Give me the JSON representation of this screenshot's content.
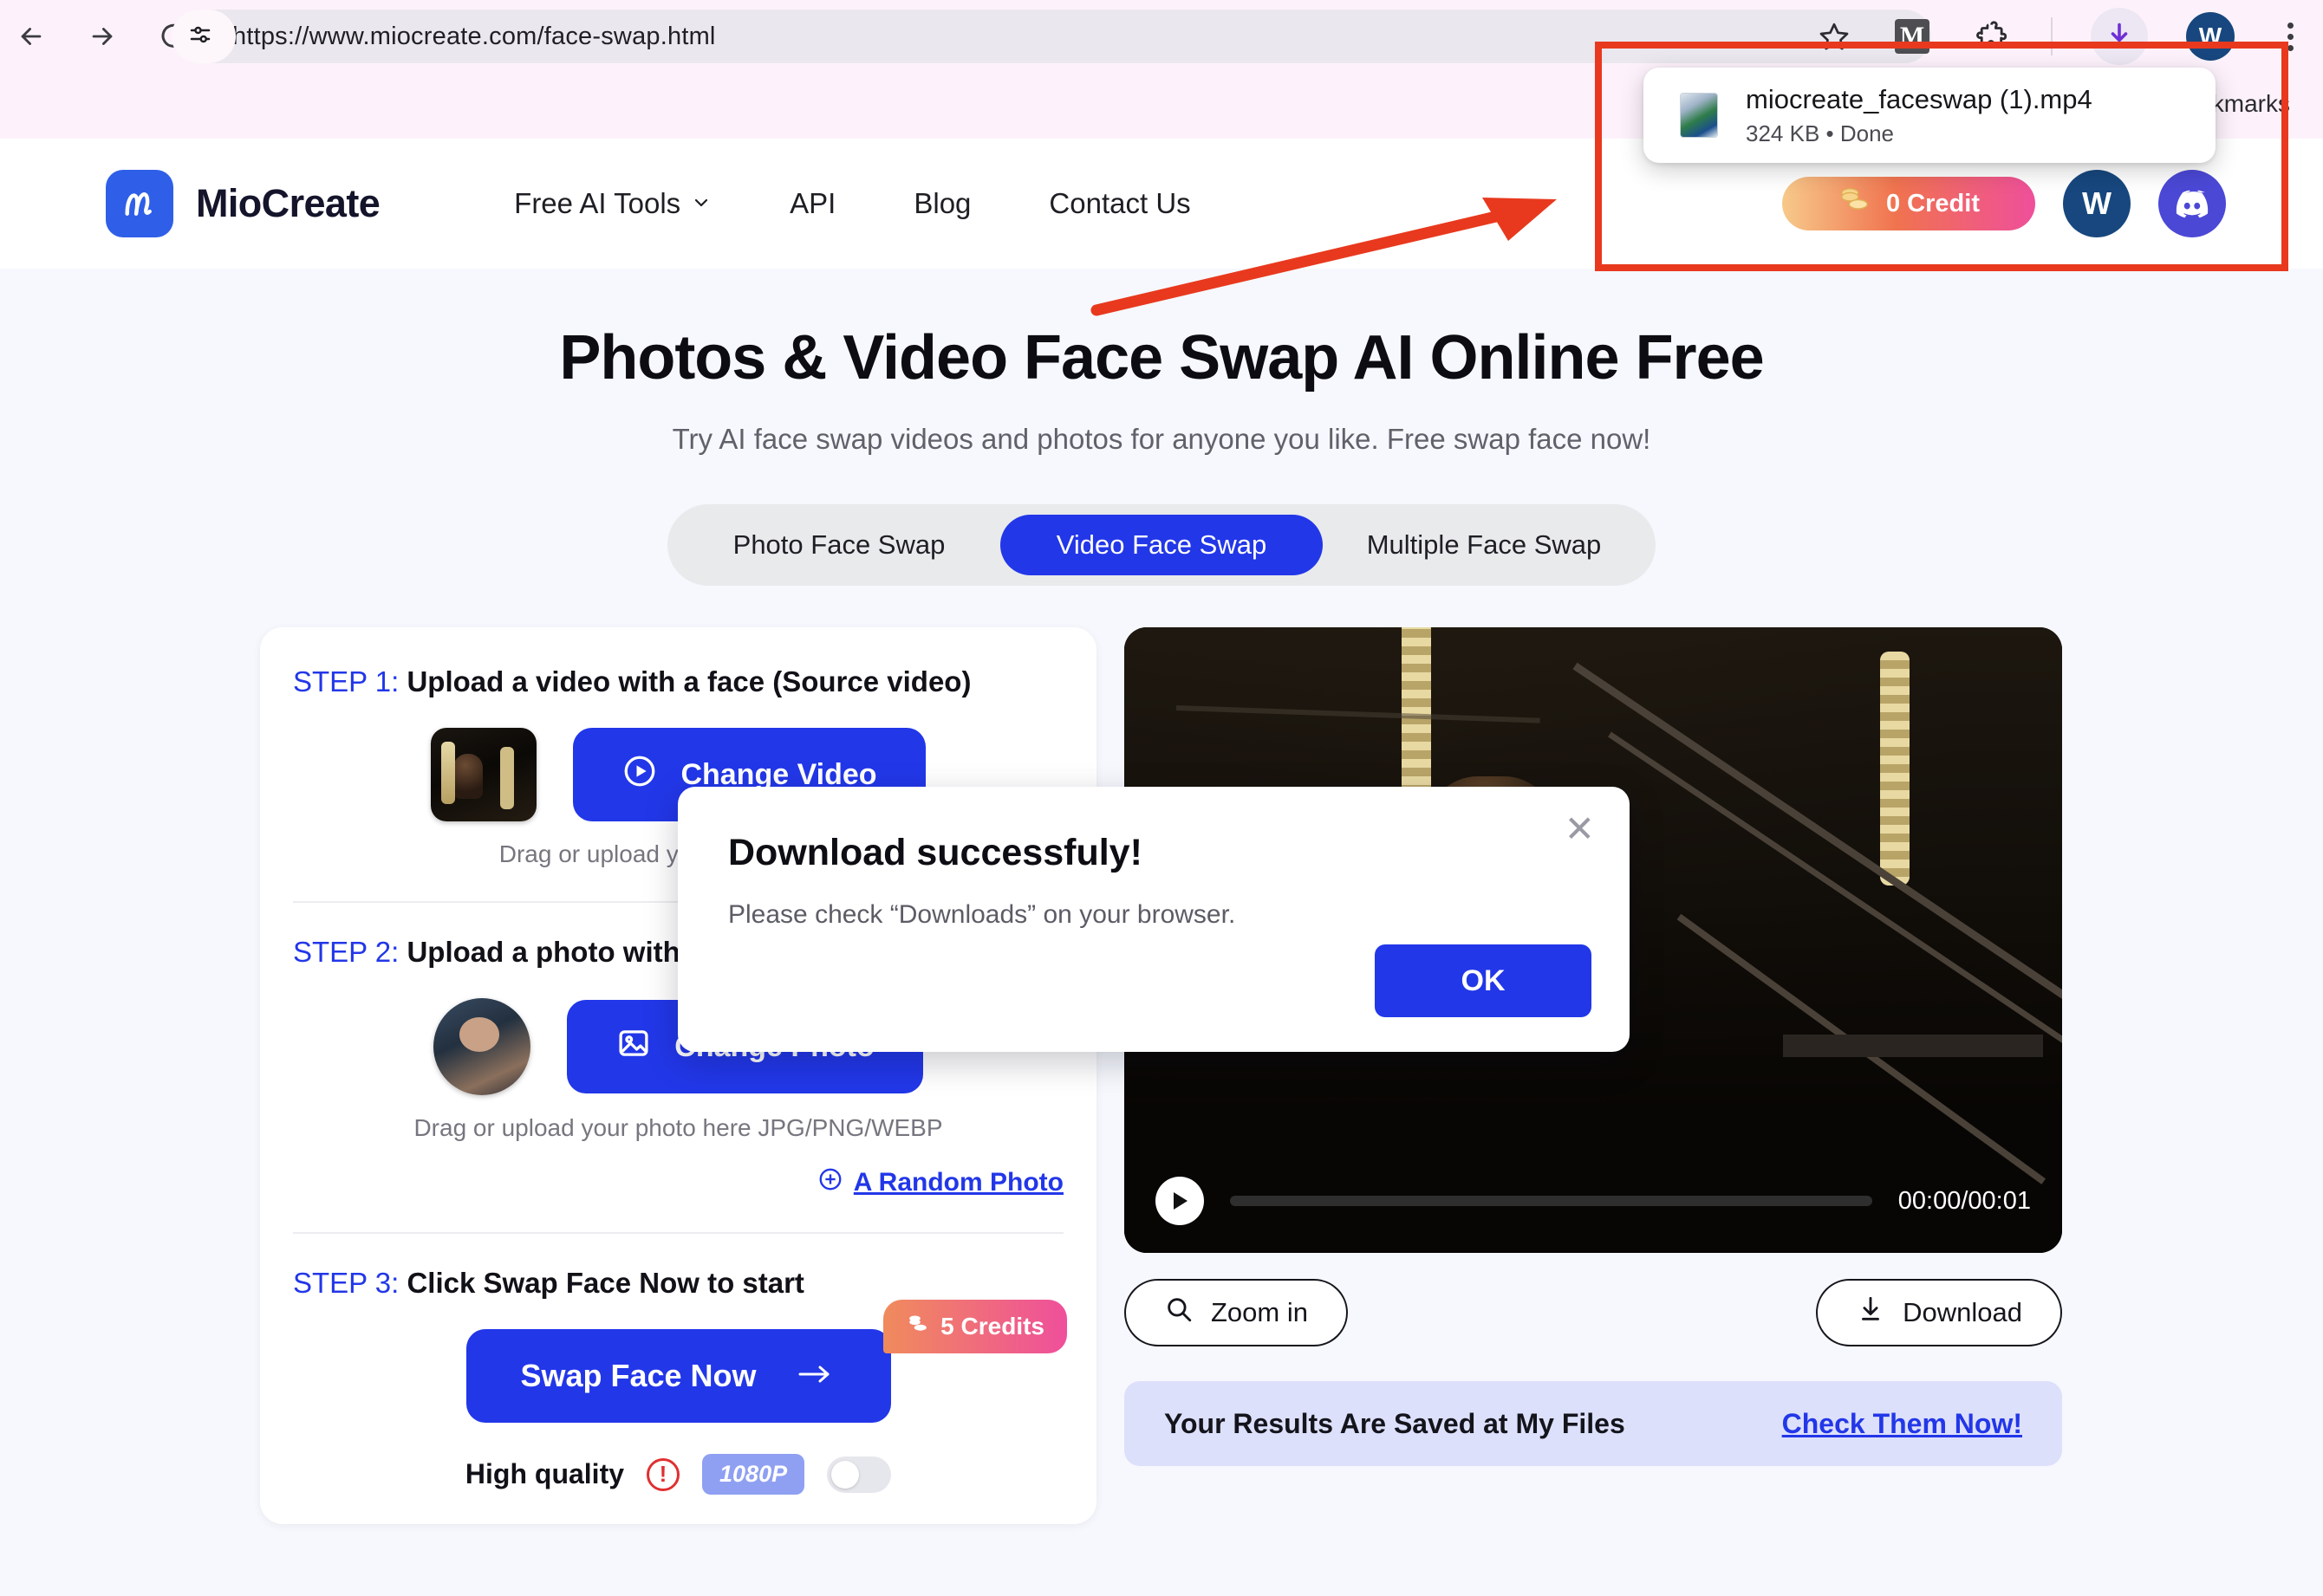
{
  "browser": {
    "url": "https://www.miocreate.com/face-swap.html",
    "back_icon": "back-arrow-icon",
    "forward_icon": "forward-arrow-icon",
    "reload_icon": "reload-icon",
    "site_info_icon": "site-settings-icon",
    "bookmark_star_icon": "star-icon",
    "extension_gmail_label": "M",
    "extension_puzzle_icon": "puzzle-icon",
    "downloads_icon": "download-icon",
    "profile_initial": "W",
    "menu_icon": "kebab-menu-icon",
    "bookmarks_label": "Bookmarks"
  },
  "download_popup": {
    "file_name": "miocreate_faceswap (1).mp4",
    "file_meta": "324 KB • Done",
    "file_icon": "video-file-icon"
  },
  "site_header": {
    "brand": "MioCreate",
    "logo_icon": "miocreate-logo-icon",
    "nav": [
      {
        "label": "Free AI Tools",
        "has_caret": true
      },
      {
        "label": "API",
        "has_caret": false
      },
      {
        "label": "Blog",
        "has_caret": false
      },
      {
        "label": "Contact Us",
        "has_caret": false
      }
    ],
    "credit_label": "0 Credit",
    "credit_icon": "coins-icon",
    "avatar_initial": "W",
    "discord_icon": "discord-icon"
  },
  "hero": {
    "title": "Photos & Video Face Swap AI Online Free",
    "subtitle": "Try AI face swap videos and photos for anyone you like. Free swap face now!"
  },
  "tabs": {
    "items": [
      {
        "label": "Photo Face Swap",
        "active": false
      },
      {
        "label": "Video Face Swap",
        "active": true
      },
      {
        "label": "Multiple Face Swap",
        "active": false
      }
    ]
  },
  "steps": {
    "step1": {
      "key": "STEP 1:",
      "title": " Upload a video with a face (Source video)",
      "button_label": "Change Video",
      "button_icon": "play-circle-icon",
      "hint": "Drag or upload your GIF or Video",
      "thumb_name": "source-video-thumbnail"
    },
    "step2": {
      "key": "STEP 2:",
      "title": " Upload a photo with a face",
      "button_label": "Change Photo",
      "button_icon": "image-icon",
      "hint": "Drag or upload your photo here JPG/PNG/WEBP",
      "random_link": "A Random Photo",
      "random_icon": "plus-circle-icon",
      "thumb_name": "source-photo-thumbnail"
    },
    "step3": {
      "key": "STEP 3:",
      "title": " Click Swap Face Now to start",
      "swap_label": "Swap Face Now",
      "swap_arrow": "arrow-right-icon",
      "credits_badge": "5 Credits",
      "credits_icon": "coins-icon",
      "quality_label": "High quality",
      "quality_warning_icon": "warning-icon",
      "resolution_chip": "1080P",
      "toggle_state": "off"
    }
  },
  "preview": {
    "play_icon": "play-icon",
    "time": "00:00/00:01",
    "progress_percent": 0,
    "zoom_in_label": "Zoom in",
    "zoom_in_icon": "magnifier-icon",
    "download_label": "Download",
    "download_icon": "download-arrow-icon",
    "saved_text": "Your Results Are Saved at My Files",
    "saved_link": "Check Them Now!"
  },
  "modal": {
    "title": "Download successfuly!",
    "body": "Please check “Downloads” on your browser.",
    "ok_label": "OK",
    "close_icon": "close-icon"
  },
  "annotations": {
    "highlight_color": "#e8391e",
    "arrow_name": "red-annotation-arrow",
    "rect_name": "red-annotation-rectangle"
  }
}
